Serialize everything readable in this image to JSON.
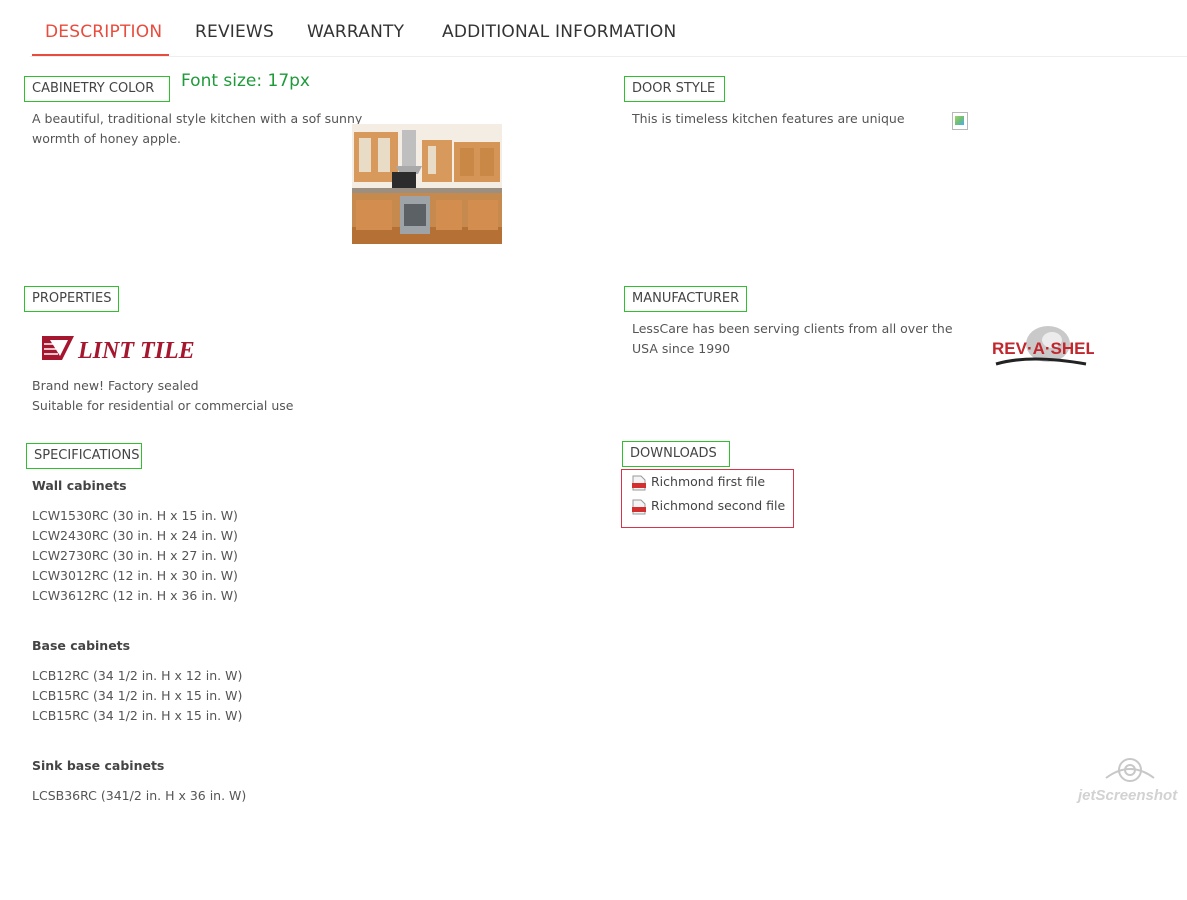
{
  "tabs": [
    {
      "label": "DESCRIPTION",
      "active": true
    },
    {
      "label": "REVIEWS",
      "active": false
    },
    {
      "label": "WARRANTY",
      "active": false
    },
    {
      "label": "ADDITIONAL INFORMATION",
      "active": false
    }
  ],
  "colors": {
    "accent": "#e84c3d",
    "annotation_box": "#2fbf2f",
    "downloads_box": "#d9334b",
    "note": "#1f9a3a"
  },
  "annotation_note": "Font size: 17px",
  "cabinetry_color": {
    "heading": "CABINETRY COLOR",
    "lines": [
      "A beautiful, traditional style kitchen with a sof sunny",
      "wormth of honey apple."
    ]
  },
  "door_style": {
    "heading": "DOOR STYLE",
    "text": "This is timeless kitchen features are unique"
  },
  "properties": {
    "heading": "PROPERTIES",
    "logo_text": "LINT TILE",
    "lines": [
      "Brand new! Factory sealed",
      "Suitable for residential or commercial use"
    ]
  },
  "manufacturer": {
    "heading": "MANUFACTURER",
    "lines": [
      "LessCare has been serving clients from all over the",
      "USA since 1990"
    ],
    "logo_text": "REV·A·SHELF"
  },
  "specifications": {
    "heading": "SPECIFICATIONS",
    "groups": [
      {
        "title": "Wall cabinets",
        "items": [
          "LCW1530RC (30 in. H x 15 in. W)",
          "LCW2430RC (30 in. H x 24 in. W)",
          "LCW2730RC (30 in. H x 27 in. W)",
          "LCW3012RC (12 in. H x 30 in. W)",
          "LCW3612RC (12 in. H x 36 in. W)"
        ]
      },
      {
        "title": "Base cabinets",
        "items": [
          "LCB12RC (34 1/2 in. H x 12 in. W)",
          "LCB15RC (34 1/2 in. H x 15 in. W)",
          "LCB15RC (34 1/2 in. H x 15 in. W)"
        ]
      },
      {
        "title": "Sink base cabinets",
        "items": [
          "LCSB36RC (341/2 in. H x 36 in. W)"
        ]
      }
    ]
  },
  "downloads": {
    "heading": "DOWNLOADS",
    "files": [
      "Richmond first file",
      "Richmond second file"
    ]
  },
  "watermark": "jetScreenshot"
}
